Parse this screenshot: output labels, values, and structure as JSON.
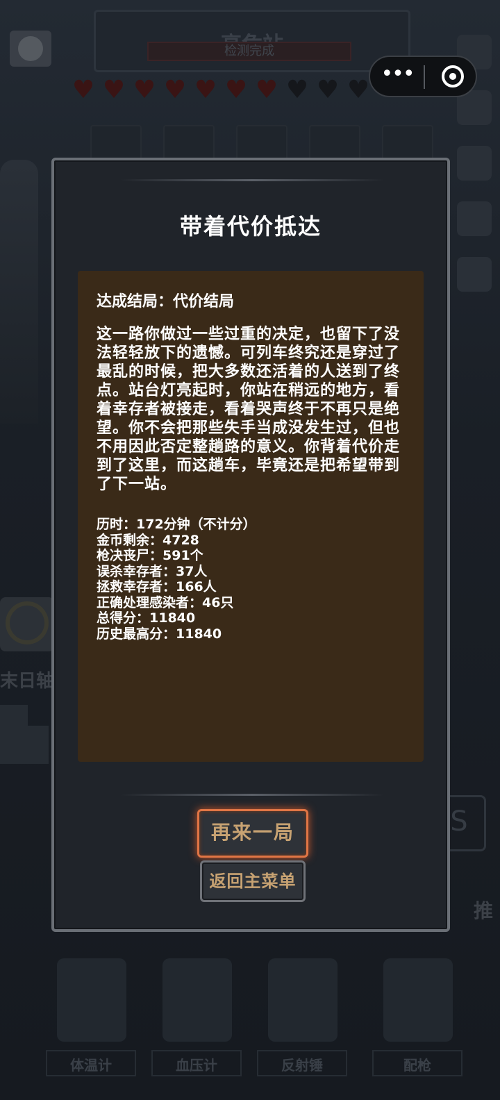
{
  "background": {
    "station_title": "高危站",
    "station_status": "检测完成",
    "hearts": {
      "filled": 7,
      "total": 10
    },
    "side_label": "末日轴",
    "right_label": "推",
    "tools": [
      {
        "label": "体温计",
        "icon": "thermometer-icon"
      },
      {
        "label": "血压计",
        "icon": "blood-pressure-icon"
      },
      {
        "label": "反射锤",
        "icon": "hammer-icon"
      },
      {
        "label": "配枪",
        "icon": "pistol-icon"
      }
    ]
  },
  "capsule": {
    "more_label": "•••",
    "close_icon": "target-icon"
  },
  "modal": {
    "title": "带着代价抵达",
    "ending_line": "达成结局：代价结局",
    "story": "这一路你做过一些过重的决定，也留下了没法轻轻放下的遗憾。可列车终究还是穿过了最乱的时候，把大多数还活着的人送到了终点。站台灯亮起时，你站在稍远的地方，看着幸存者被接走，看着哭声终于不再只是绝望。你不会把那些失手当成没发生过，但也不用因此否定整趟路的意义。你背着代价走到了这里，而这趟车，毕竟还是把希望带到了下一站。",
    "stats": [
      "历时：172分钟（不计分）",
      "金币剩余：4728",
      "枪决丧尸：591个",
      "误杀幸存者：37人",
      "拯救幸存者：166人",
      "正确处理感染者：46只",
      "总得分：11840",
      "历史最高分：11840"
    ],
    "restart_label": "再来一局",
    "menu_label": "返回主菜单"
  },
  "colors": {
    "accent_orange": "#e07545",
    "button_text": "#c7a272",
    "content_bg": "#3a2a18",
    "modal_bg": "#20242a"
  }
}
